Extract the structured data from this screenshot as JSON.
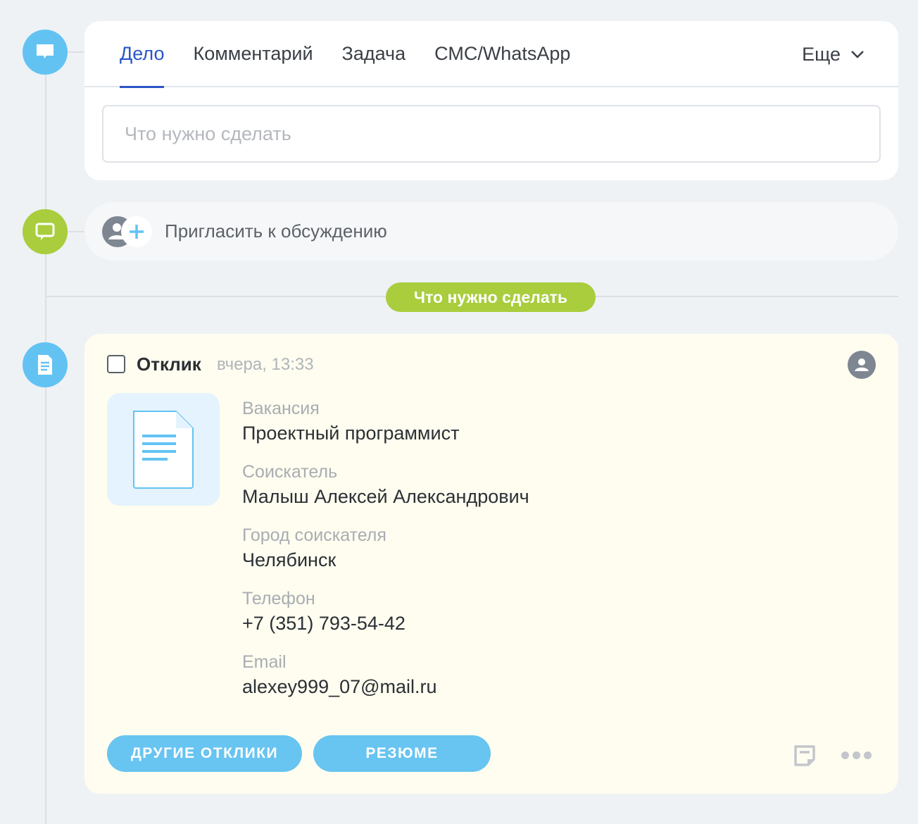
{
  "tabs": [
    {
      "label": "Дело"
    },
    {
      "label": "Комментарий"
    },
    {
      "label": "Задача"
    },
    {
      "label": "СМС/WhatsApp"
    }
  ],
  "more_label": "Еще",
  "task_input": {
    "placeholder": "Что нужно сделать",
    "value": ""
  },
  "invite_label": "Пригласить к обсуждению",
  "section_badge": "Что нужно сделать",
  "entry": {
    "title": "Отклик",
    "time": "вчера, 13:33",
    "fields": [
      {
        "label": "Вакансия",
        "value": "Проектный программист"
      },
      {
        "label": "Соискатель",
        "value": "Малыш Алексей Александрович"
      },
      {
        "label": "Город соискателя",
        "value": "Челябинск"
      },
      {
        "label": "Телефон",
        "value": "+7 (351) 793-54-42"
      },
      {
        "label": "Email",
        "value": "alexey999_07@mail.ru"
      }
    ],
    "buttons": {
      "other": "ДРУГИЕ ОТКЛИКИ",
      "resume": "РЕЗЮМЕ"
    }
  },
  "colors": {
    "accent": "#2a56c6",
    "blue": "#62c3f3",
    "green": "#a9cd3d",
    "card_yellow": "#fefdf0"
  }
}
